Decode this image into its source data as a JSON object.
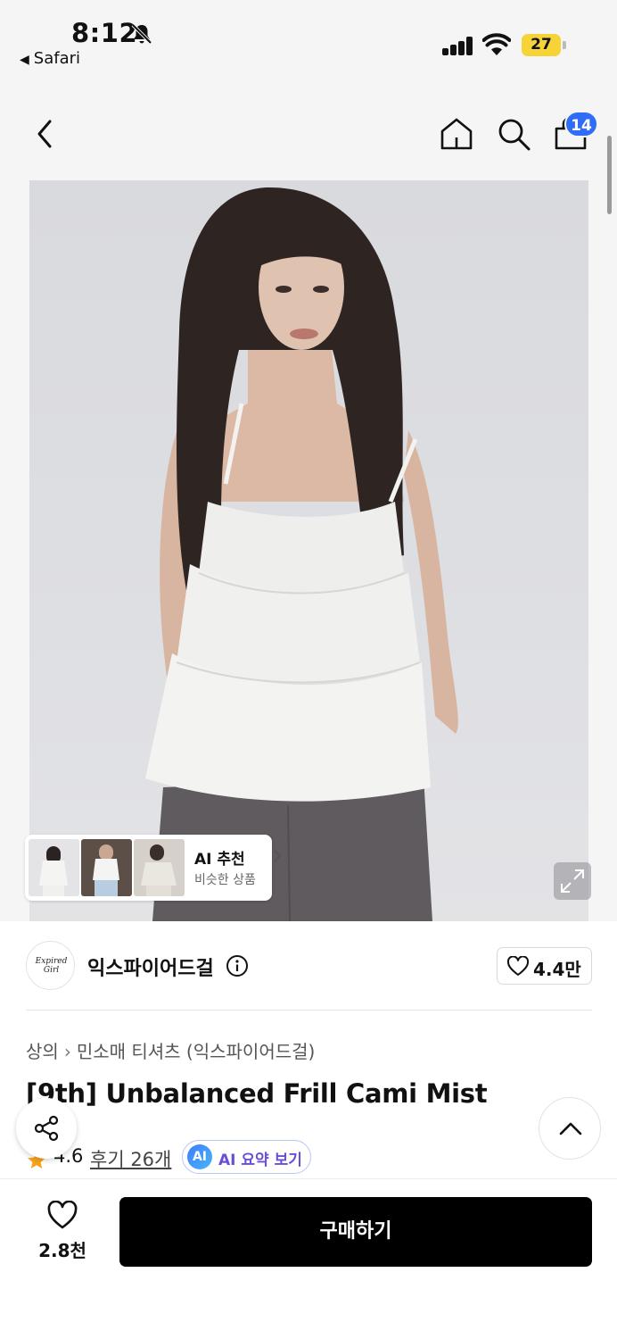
{
  "status_bar": {
    "time": "8:12",
    "back_app": "Safari",
    "battery": "27",
    "colors": {
      "battery": "#f6d438"
    }
  },
  "nav": {
    "cart_count": "14",
    "icons": [
      "chevron-left-icon",
      "home-icon",
      "search-icon",
      "shopping-bag-icon"
    ],
    "colors": {
      "badge": "#2f6df6"
    }
  },
  "product_image": {
    "ai_recommend": {
      "title": "AI 추천",
      "subtitle": "비슷한 상품",
      "thumbnail_count": 3
    }
  },
  "brand": {
    "name": "익스파이어드걸",
    "logo_text": "Expired Girl",
    "likes": "4.4만"
  },
  "product": {
    "breadcrumb": [
      "상의",
      "민소매 티셔츠 (익스파이어드걸)"
    ],
    "title": "[9th] Unbalanced Frill Cami Mist",
    "rating": "4.6",
    "reviews": "후기 26개",
    "ai_badge": "AI",
    "ai_summary": "AI 요약 보기"
  },
  "bottom_bar": {
    "wish_count": "2.8천",
    "buy_label": "구매하기"
  }
}
